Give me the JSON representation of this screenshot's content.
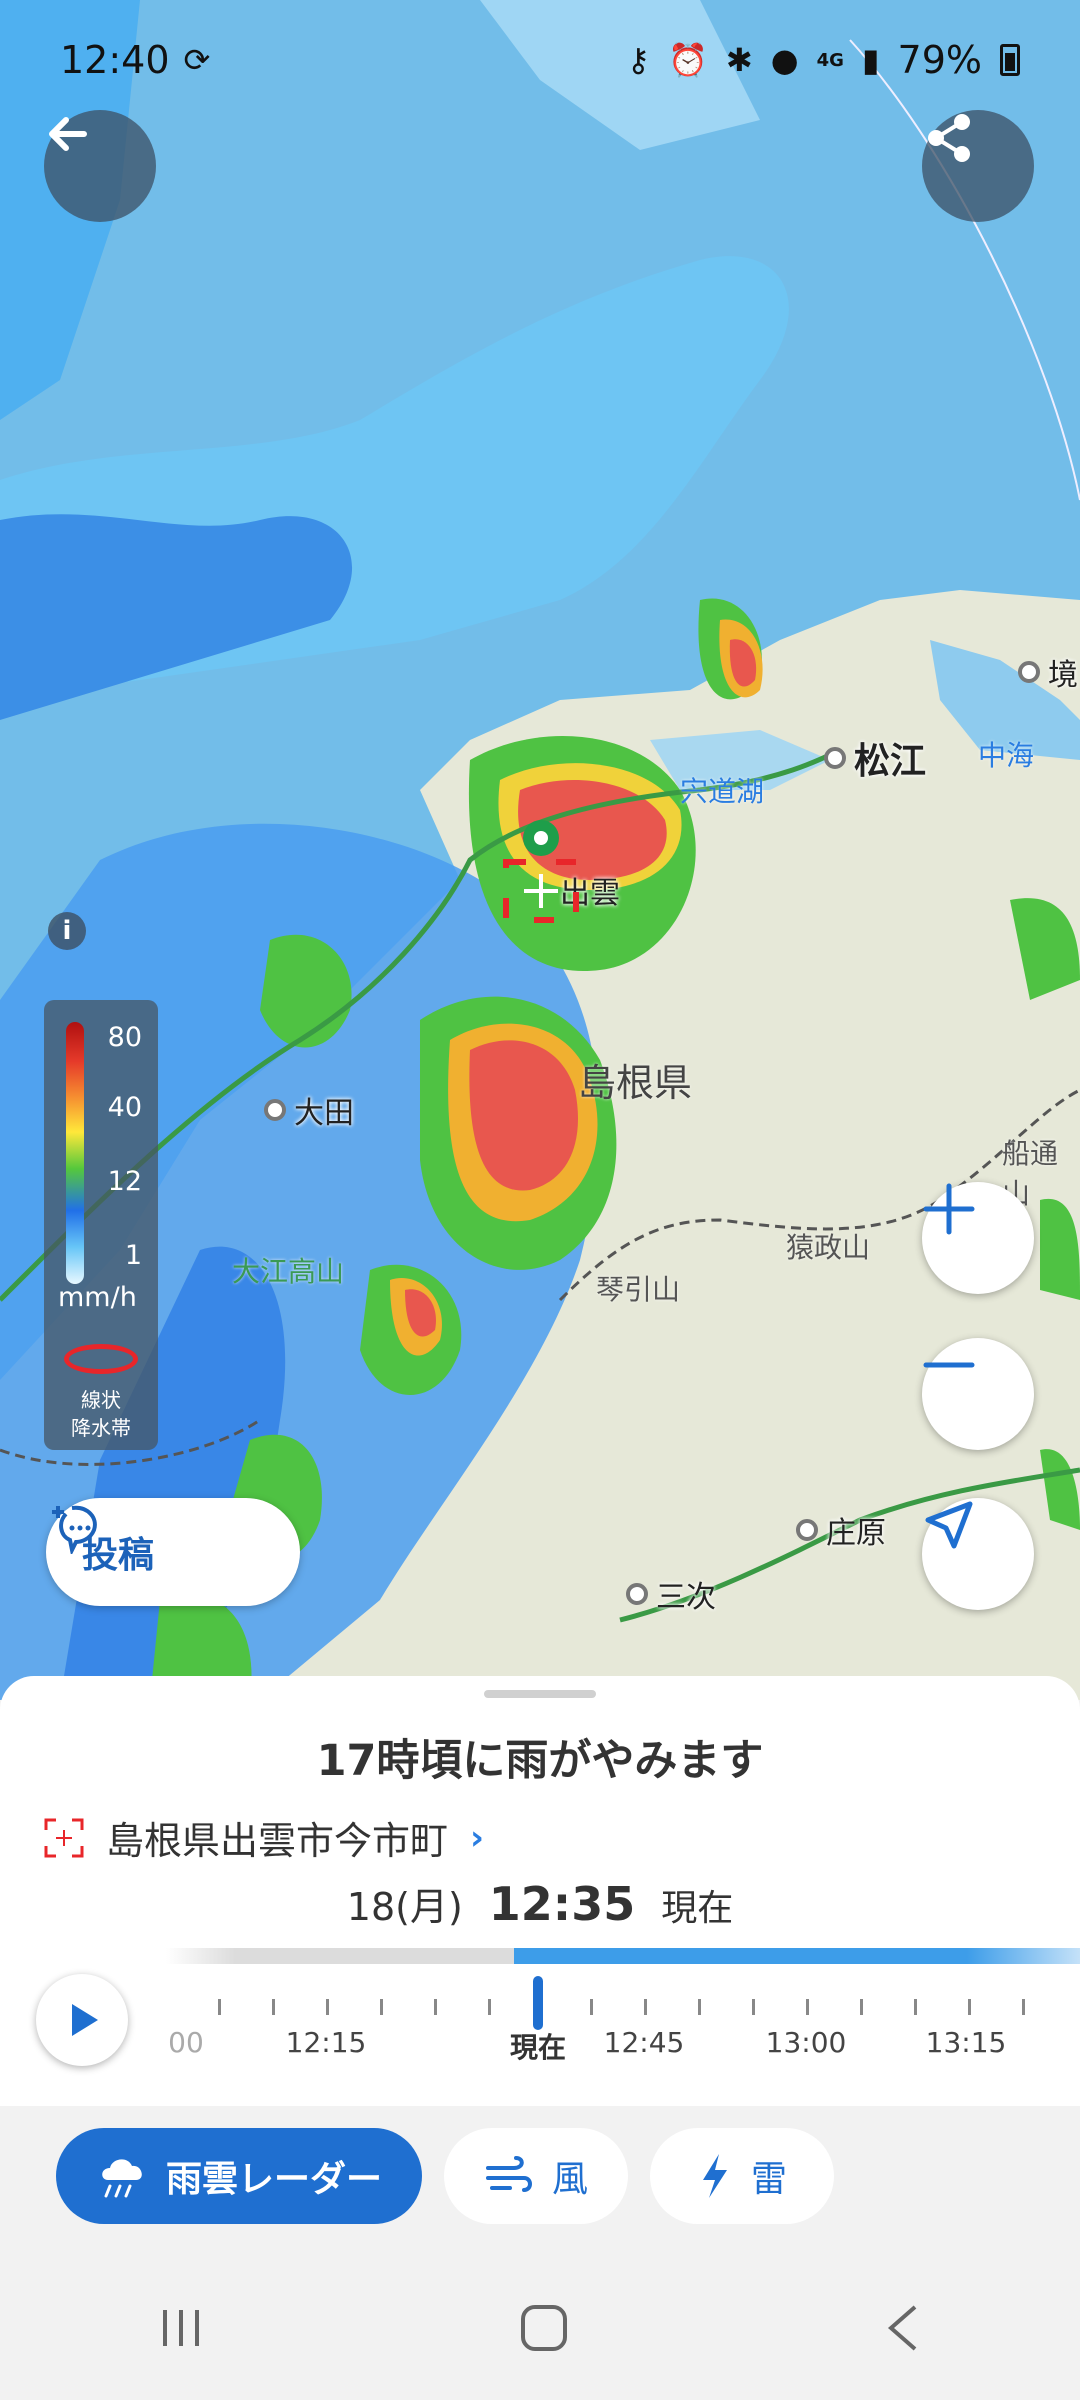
{
  "status_bar": {
    "time": "12:40",
    "network": "4G",
    "battery": "79%"
  },
  "map": {
    "places": {
      "matsue": "松江",
      "izumo": "出雲",
      "ohda": "大田",
      "shobara": "庄原",
      "miyoshi": "三次",
      "sakai": "境"
    },
    "labels": {
      "prefecture": "島根県",
      "lake_shinji": "宍道湖",
      "nakaumi": "中海",
      "mt_ooe": "大江高山",
      "mt_sarumasa": "猿政山",
      "mt_kotobiki": "琴引山",
      "mt_funatsu": "船通山"
    }
  },
  "legend": {
    "values": [
      "80",
      "40",
      "12",
      "1"
    ],
    "unit": "mm/h",
    "band_label_1": "線状",
    "band_label_2": "降水帯"
  },
  "post_button": {
    "label": "投稿"
  },
  "sheet": {
    "headline": "17時頃に雨がやみます",
    "location": "島根県出雲市今市町",
    "date": "18(月)",
    "time": "12:35",
    "now_label": "現在",
    "timeline_labels": [
      "00",
      "12:15",
      "現在",
      "12:45",
      "13:00",
      "13:15"
    ]
  },
  "tabs": {
    "rain": "雨雲レーダー",
    "wind": "風",
    "thunder": "雷"
  }
}
